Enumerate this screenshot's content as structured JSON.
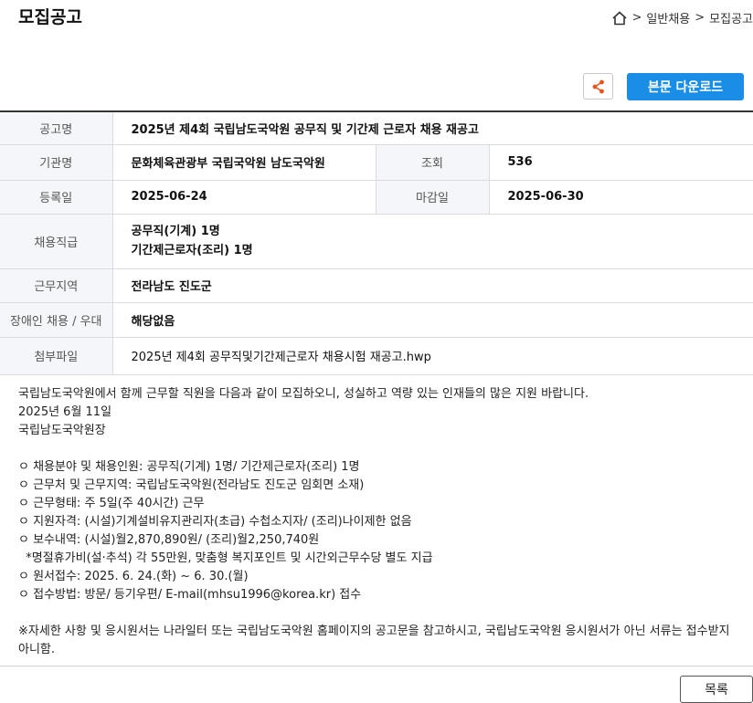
{
  "page": {
    "title": "모집공고"
  },
  "breadcrumb": {
    "items": [
      "일반채용",
      "모집공고"
    ],
    "separator": ">"
  },
  "actions": {
    "download_label": "본문 다운로드",
    "share_icon": "share-icon"
  },
  "info": {
    "notice_label": "공고명",
    "notice_value": "2025년 제4회 국립남도국악원 공무직 및 기간제 근로자 채용 재공고",
    "org_label": "기관명",
    "org_value": "문화체육관광부 국립국악원 남도국악원",
    "views_label": "조회",
    "views_value": "536",
    "reg_label": "등록일",
    "reg_value": "2025-06-24",
    "deadline_label": "마감일",
    "deadline_value": "2025-06-30",
    "position_label": "채용직급",
    "position_line1": "공무직(기계) 1명",
    "position_line2": "기간제근로자(조리) 1명",
    "region_label": "근무지역",
    "region_value": "전라남도 진도군",
    "disability_label": "장애인 채용 / 우대",
    "disability_value": "해당없음",
    "file_label": "첨부파일",
    "file_value": "2025년 제4회 공무직및기간제근로자 채용시험 재공고.hwp"
  },
  "body": {
    "intro": "국립남도국악원에서 함께 근무할 직원을 다음과 같이 모집하오니, 성실하고 역량 있는 인재들의 많은 지원 바랍니다.",
    "date": "2025년 6월 11일",
    "signer": "국립남도국악원장",
    "items": [
      "ㅇ 채용분야 및 채용인원: 공무직(기계) 1명/ 기간제근로자(조리) 1명",
      "ㅇ 근무처 및 근무지역: 국립남도국악원(전라남도 진도군 임회면 소재)",
      "ㅇ 근무형태: 주 5일(주 40시간) 근무",
      "ㅇ 지원자격: (시설)기계설비유지관리자(초급) 수첩소지자/ (조리)나이제한 없음",
      "ㅇ 보수내역: (시설)월2,870,890원/ (조리)월2,250,740원",
      "  *명절휴가비(설·추석) 각 55만원, 맞춤형 복지포인트 및 시간외근무수당 별도 지급",
      "ㅇ 원서접수: 2025. 6. 24.(화) ~ 6. 30.(월)",
      "ㅇ 접수방법: 방문/ 등기우편/ E-mail(mhsu1996@korea.kr) 접수"
    ],
    "note": "※자세한 사항 및 응시원서는 나라일터 또는 국립남도국악원 홈페이지의 공고문을 참고하시고, 국립남도국악원 응시원서가 아닌 서류는 접수받지 아니함."
  },
  "footer": {
    "list_label": "목록"
  },
  "colors": {
    "accent": "#1a8ee6",
    "share_icon": "#e8531f",
    "label_bg": "#f4f6f9"
  }
}
